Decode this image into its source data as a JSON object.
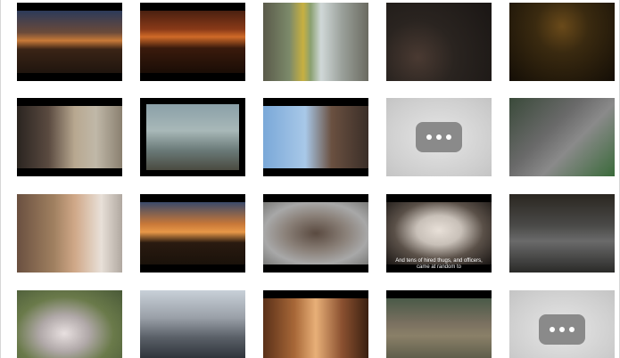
{
  "grid": {
    "thumbnails": [
      {
        "name": "thumbnail-night-crowd-fireworks",
        "kind": "photo"
      },
      {
        "name": "thumbnail-night-crowd-fire",
        "kind": "photo"
      },
      {
        "name": "thumbnail-street-pole",
        "kind": "photo"
      },
      {
        "name": "thumbnail-dense-crowd-heads",
        "kind": "photo"
      },
      {
        "name": "thumbnail-dark-crowd-lights",
        "kind": "photo"
      },
      {
        "name": "thumbnail-man-city-street",
        "kind": "photo"
      },
      {
        "name": "thumbnail-tv-screen-smoke",
        "kind": "photo"
      },
      {
        "name": "thumbnail-man-smiling-river",
        "kind": "photo"
      },
      {
        "name": "thumbnail-loading-placeholder",
        "kind": "placeholder"
      },
      {
        "name": "thumbnail-aerial-crowd-street",
        "kind": "photo"
      },
      {
        "name": "thumbnail-crowd-street-buildings",
        "kind": "photo"
      },
      {
        "name": "thumbnail-square-crowd-sunset",
        "kind": "photo"
      },
      {
        "name": "thumbnail-aerial-square-crowd",
        "kind": "photo"
      },
      {
        "name": "thumbnail-woman-headscarf-interview",
        "kind": "photo",
        "caption": "And tens of hired thugs, and officers, came at random to"
      },
      {
        "name": "thumbnail-night-crowd-overhead",
        "kind": "photo"
      },
      {
        "name": "thumbnail-elderly-woman-portrait",
        "kind": "photo"
      },
      {
        "name": "thumbnail-police-street-line",
        "kind": "photo"
      },
      {
        "name": "thumbnail-room-people-lamp",
        "kind": "photo"
      },
      {
        "name": "thumbnail-tanks-street",
        "kind": "photo"
      },
      {
        "name": "thumbnail-loading-placeholder-2",
        "kind": "placeholder"
      }
    ]
  },
  "placeholder_icon": "more-horizontal-icon",
  "colors": {
    "letterbox": "#000000",
    "placeholder_bg": "#d4d4d4",
    "placeholder_button": "#8a8a8a"
  }
}
